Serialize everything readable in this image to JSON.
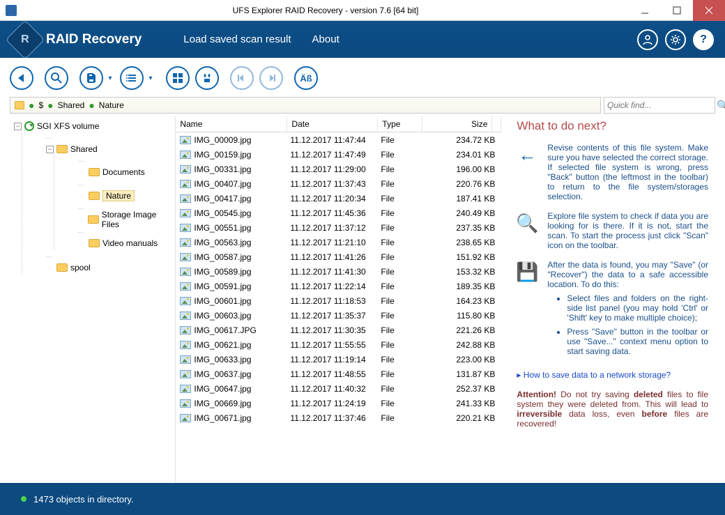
{
  "window": {
    "title": "UFS Explorer RAID Recovery - version 7.6 [64 bit]"
  },
  "header": {
    "brand": "RAID Recovery",
    "menu_load": "Load saved scan result",
    "menu_about": "About"
  },
  "breadcrumb": {
    "seg0": "$",
    "seg1": "Shared",
    "seg2": "Nature"
  },
  "quickfind": {
    "placeholder": "Quick find..."
  },
  "tree": {
    "root": "SGI XFS volume",
    "shared": "Shared",
    "documents": "Documents",
    "nature": "Nature",
    "storage": "Storage Image Files",
    "video": "Video manuals",
    "spool": "spool"
  },
  "columns": {
    "name": "Name",
    "date": "Date",
    "type": "Type",
    "size": "Size"
  },
  "files": [
    {
      "name": "IMG_00009.jpg",
      "date": "11.12.2017 11:47:44",
      "type": "File",
      "size": "234.72 KB"
    },
    {
      "name": "IMG_00159.jpg",
      "date": "11.12.2017 11:47:49",
      "type": "File",
      "size": "234.01 KB"
    },
    {
      "name": "IMG_00331.jpg",
      "date": "11.12.2017 11:29:00",
      "type": "File",
      "size": "196.00 KB"
    },
    {
      "name": "IMG_00407.jpg",
      "date": "11.12.2017 11:37:43",
      "type": "File",
      "size": "220.76 KB"
    },
    {
      "name": "IMG_00417.jpg",
      "date": "11.12.2017 11:20:34",
      "type": "File",
      "size": "187.41 KB"
    },
    {
      "name": "IMG_00545.jpg",
      "date": "11.12.2017 11:45:36",
      "type": "File",
      "size": "240.49 KB"
    },
    {
      "name": "IMG_00551.jpg",
      "date": "11.12.2017 11:37:12",
      "type": "File",
      "size": "237.35 KB"
    },
    {
      "name": "IMG_00563.jpg",
      "date": "11.12.2017 11:21:10",
      "type": "File",
      "size": "238.65 KB"
    },
    {
      "name": "IMG_00587.jpg",
      "date": "11.12.2017 11:41:26",
      "type": "File",
      "size": "151.92 KB"
    },
    {
      "name": "IMG_00589.jpg",
      "date": "11.12.2017 11:41:30",
      "type": "File",
      "size": "153.32 KB"
    },
    {
      "name": "IMG_00591.jpg",
      "date": "11.12.2017 11:22:14",
      "type": "File",
      "size": "189.35 KB"
    },
    {
      "name": "IMG_00601.jpg",
      "date": "11.12.2017 11:18:53",
      "type": "File",
      "size": "164.23 KB"
    },
    {
      "name": "IMG_00603.jpg",
      "date": "11.12.2017 11:35:37",
      "type": "File",
      "size": "115.80 KB"
    },
    {
      "name": "IMG_00617.JPG",
      "date": "11.12.2017 11:30:35",
      "type": "File",
      "size": "221.26 KB"
    },
    {
      "name": "IMG_00621.jpg",
      "date": "11.12.2017 11:55:55",
      "type": "File",
      "size": "242.88 KB"
    },
    {
      "name": "IMG_00633.jpg",
      "date": "11.12.2017 11:19:14",
      "type": "File",
      "size": "223.00 KB"
    },
    {
      "name": "IMG_00637.jpg",
      "date": "11.12.2017 11:48:55",
      "type": "File",
      "size": "131.87 KB"
    },
    {
      "name": "IMG_00647.jpg",
      "date": "11.12.2017 11:40:32",
      "type": "File",
      "size": "252.37 KB"
    },
    {
      "name": "IMG_00669.jpg",
      "date": "11.12.2017 11:24:19",
      "type": "File",
      "size": "241.33 KB"
    },
    {
      "name": "IMG_00671.jpg",
      "date": "11.12.2017 11:37:46",
      "type": "File",
      "size": "220.21 KB"
    }
  ],
  "help": {
    "title": "What to do next?",
    "p1": "Revise contents of this file system. Make sure you have selected the correct storage. If selected file system is wrong, press \"Back\" button (the leftmost in the toolbar) to return to the file system/storages selection.",
    "p2": "Explore file system to check if data you are looking for is there. If it is not, start the scan. To start the process just click \"Scan\" icon on the toolbar.",
    "p3": "After the data is found, you may \"Save\" (or \"Recover\") the data to a safe accessible location. To do this:",
    "b1": "Select files and folders on the right-side list panel (you may hold 'Ctrl' or 'Shift' key to make multiple choice);",
    "b2": "Press \"Save\" button in the toolbar or use \"Save...\" context menu option to start saving data.",
    "link": "How to save data to a network storage?",
    "attn_label": "Attention!",
    "attn1": " Do not try saving ",
    "attn_b1": "deleted",
    "attn2": " files to file system they were deleted from. This will lead to ",
    "attn_b2": "irreversible",
    "attn3": " data loss, even ",
    "attn_b3": "before",
    "attn4": " files are recovered!"
  },
  "status": {
    "text": "1473 objects in directory."
  }
}
